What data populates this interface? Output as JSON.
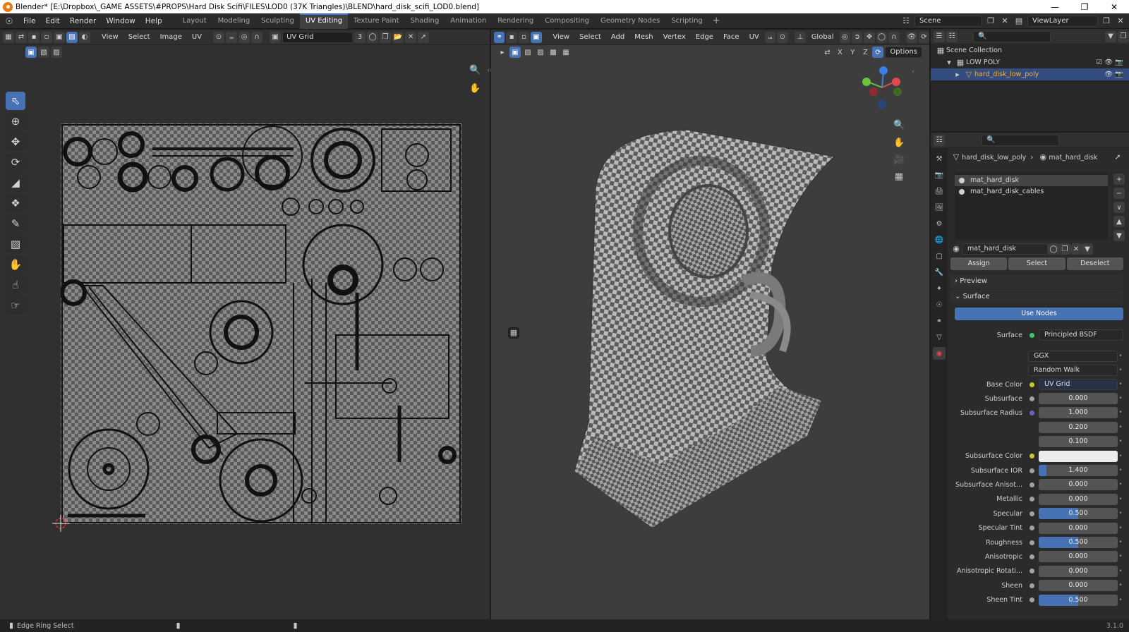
{
  "titlebar": {
    "title": "Blender* [E:\\Dropbox\\_GAME ASSETS\\#PROPS\\Hard Disk Scifi\\FILES\\LOD0 (37K Triangles)\\BLEND\\hard_disk_scifi_LOD0.blend]"
  },
  "menu": [
    "File",
    "Edit",
    "Render",
    "Window",
    "Help"
  ],
  "workspaces": [
    "Layout",
    "Modeling",
    "Sculpting",
    "UV Editing",
    "Texture Paint",
    "Shading",
    "Animation",
    "Rendering",
    "Compositing",
    "Geometry Nodes",
    "Scripting"
  ],
  "active_workspace": "UV Editing",
  "scene": "Scene",
  "viewlayer": "ViewLayer",
  "uv_editor": {
    "menus": [
      "View",
      "Select",
      "Image",
      "UV"
    ],
    "image_name": "UV Grid",
    "users": "3"
  },
  "viewport": {
    "menus": [
      "View",
      "Select",
      "Add",
      "Mesh",
      "Vertex",
      "Edge",
      "Face",
      "UV"
    ],
    "transform": "Global",
    "axes": [
      "X",
      "Y",
      "Z"
    ],
    "options": "Options"
  },
  "outliner": {
    "collection": "Scene Collection",
    "sub_collection": "LOW POLY",
    "object": "hard_disk_low_poly"
  },
  "properties": {
    "breadcrumb_object": "hard_disk_low_poly",
    "breadcrumb_material": "mat_hard_disk",
    "materials": [
      "mat_hard_disk",
      "mat_hard_disk_cables"
    ],
    "material_name": "mat_hard_disk",
    "buttons": {
      "assign": "Assign",
      "select": "Select",
      "deselect": "Deselect"
    },
    "preview": "Preview",
    "surface_panel": "Surface",
    "use_nodes": "Use Nodes",
    "surface_label": "Surface",
    "surface_shader": "Principled BSDF",
    "distribution": "GGX",
    "subsurface_method": "Random Walk",
    "base_color_label": "Base Color",
    "base_color_value": "UV Grid",
    "fields": [
      {
        "label": "Subsurface",
        "value": "0.000",
        "fill": 0
      },
      {
        "label": "Subsurface Radius",
        "value": "1.000",
        "fill": 0
      },
      {
        "label": "",
        "value": "0.200",
        "fill": 0
      },
      {
        "label": "",
        "value": "0.100",
        "fill": 0
      },
      {
        "label": "Subsurface Color",
        "value": "",
        "fill": 0
      },
      {
        "label": "Subsurface IOR",
        "value": "1.400",
        "fill": 0.1
      },
      {
        "label": "Subsurface Anisot...",
        "value": "0.000",
        "fill": 0
      },
      {
        "label": "Metallic",
        "value": "0.000",
        "fill": 0
      },
      {
        "label": "Specular",
        "value": "0.500",
        "fill": 0.5
      },
      {
        "label": "Specular Tint",
        "value": "0.000",
        "fill": 0
      },
      {
        "label": "Roughness",
        "value": "0.500",
        "fill": 0.5
      },
      {
        "label": "Anisotropic",
        "value": "0.000",
        "fill": 0
      },
      {
        "label": "Anisotropic Rotati...",
        "value": "0.000",
        "fill": 0
      },
      {
        "label": "Sheen",
        "value": "0.000",
        "fill": 0
      },
      {
        "label": "Sheen Tint",
        "value": "0.500",
        "fill": 0.5
      }
    ]
  },
  "status": {
    "left": "Edge Ring Select",
    "version": "3.1.0"
  },
  "colors": {
    "accent": "#4772b3",
    "area": "#303030",
    "panel": "#2b2b2b"
  }
}
